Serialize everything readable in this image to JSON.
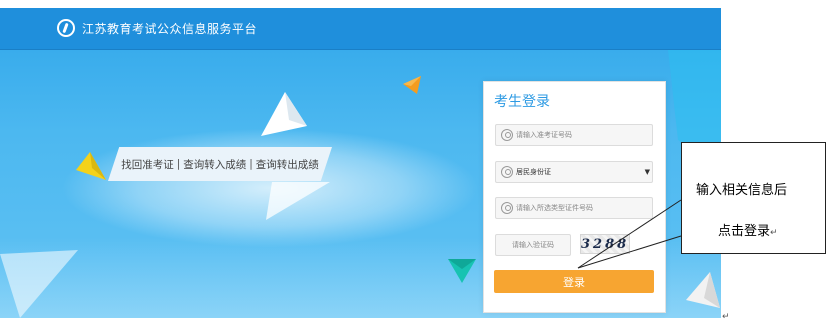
{
  "header": {
    "site_title": "江苏教育考试公众信息服务平台",
    "logo_icon": "shield-pen-icon"
  },
  "links": {
    "items": [
      "找回准考证",
      "查询转入成绩",
      "查询转出成绩"
    ],
    "separator": "|"
  },
  "login": {
    "title": "考生登录",
    "exam_id_placeholder": "请输入准考证号码",
    "id_type_value": "居民身份证",
    "id_number_placeholder": "请输入所选类型证件号码",
    "captcha_placeholder": "请输入验证码",
    "captcha_text": "3288",
    "submit_label": "登录"
  },
  "annotation": {
    "line1": "输入相关信息后",
    "line2": "点击登录",
    "para_mark": "↵"
  },
  "colors": {
    "header_bg": "#1f8fdc",
    "title_blue": "#2d9ae3",
    "button_orange": "#f7a531"
  }
}
